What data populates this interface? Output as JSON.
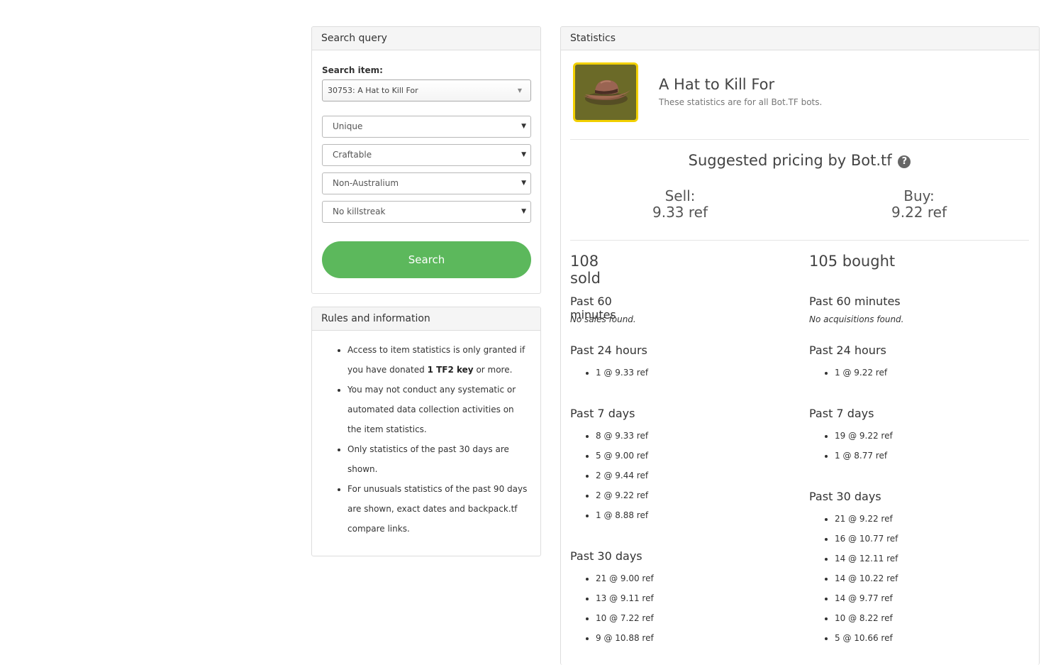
{
  "search": {
    "title": "Search query",
    "item_label": "Search item:",
    "item_value": "30753: A Hat to Kill For",
    "quality": "Unique",
    "craftable": "Craftable",
    "australium": "Non-Australium",
    "killstreak": "No killstreak",
    "button_label": "Search"
  },
  "rules": {
    "title": "Rules and information",
    "r1_a": "Access to item statistics is only granted if you have donated ",
    "r1_b": "1 TF2 key",
    "r1_c": " or more.",
    "r2": "You may not conduct any systematic or automated data collection activities on the item statistics.",
    "r3": "Only statistics of the past 30 days are shown.",
    "r4": "For unusuals statistics of the past 90 days are shown, exact dates and backpack.tf compare links."
  },
  "stats": {
    "title": "Statistics",
    "item_name": "A Hat to Kill For",
    "item_subtitle": "These statistics are for all Bot.TF bots.",
    "suggest_title": "Suggested pricing by Bot.tf",
    "sell_label": "Sell:",
    "sell_value": "9.33 ref",
    "buy_label": "Buy:",
    "buy_value": "9.22 ref",
    "sold": {
      "count": "108 sold",
      "p60_title": "Past 60 minutes",
      "p60_none": "No sales found.",
      "p24_title": "Past 24 hours",
      "p24": [
        "1 @ 9.33 ref"
      ],
      "p7_title": "Past 7 days",
      "p7": [
        "8 @ 9.33 ref",
        "5 @ 9.00 ref",
        "2 @ 9.44 ref",
        "2 @ 9.22 ref",
        "1 @ 8.88 ref"
      ],
      "p30_title": "Past 30 days",
      "p30": [
        "21 @ 9.00 ref",
        "13 @ 9.11 ref",
        "10 @ 7.22 ref",
        "9 @ 10.88 ref"
      ]
    },
    "bought": {
      "count": "105 bought",
      "p60_title": "Past 60 minutes",
      "p60_none": "No acquisitions found.",
      "p24_title": "Past 24 hours",
      "p24": [
        "1 @ 9.22 ref"
      ],
      "p7_title": "Past 7 days",
      "p7": [
        "19 @ 9.22 ref",
        "1 @ 8.77 ref"
      ],
      "p30_title": "Past 30 days",
      "p30": [
        "21 @ 9.22 ref",
        "16 @ 10.77 ref",
        "14 @ 12.11 ref",
        "14 @ 10.22 ref",
        "14 @ 9.77 ref",
        "10 @ 8.22 ref",
        "5 @ 10.66 ref"
      ]
    }
  }
}
